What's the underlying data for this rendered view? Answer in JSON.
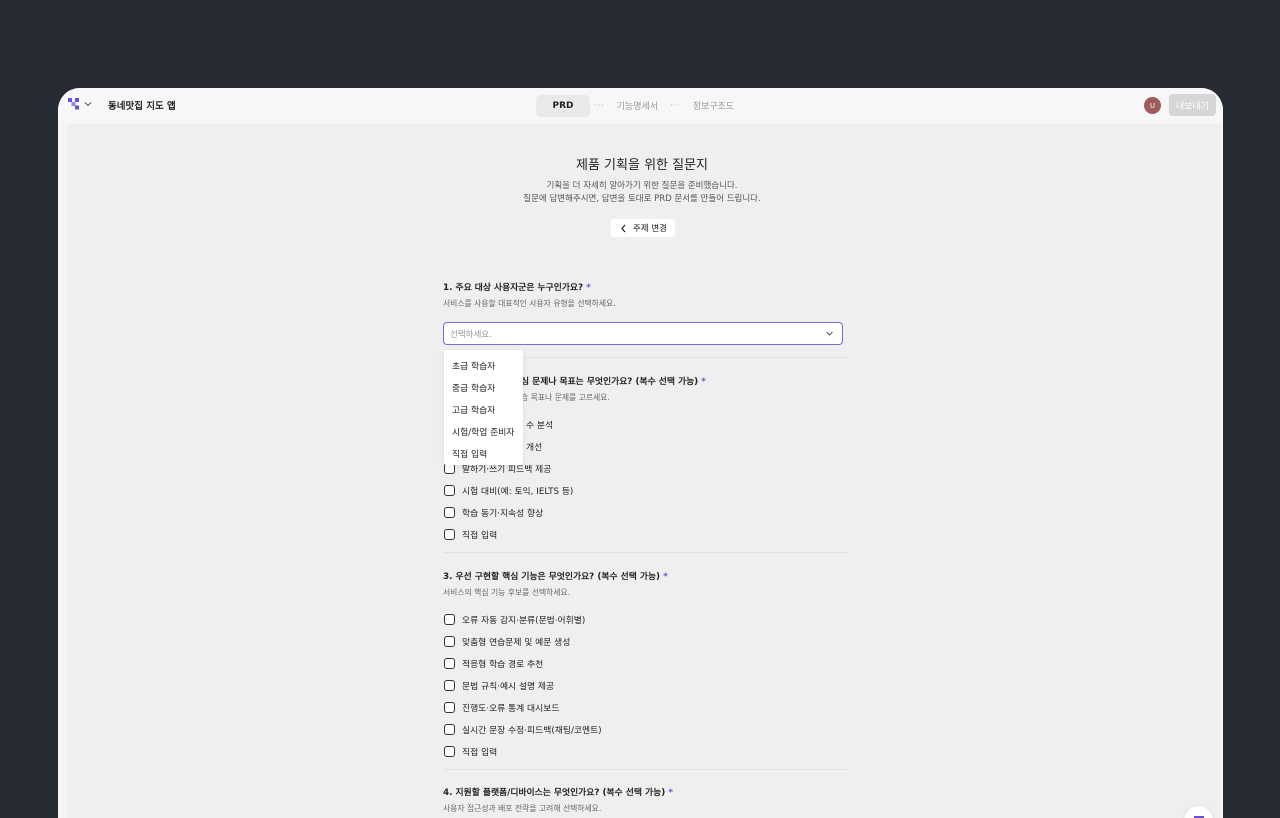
{
  "header": {
    "project_title": "동네맛집 지도 앱",
    "steps": [
      "PRD",
      "기능명세서",
      "정보구조도"
    ],
    "step_separator": "···",
    "avatar_initial": "U",
    "export_label": "내보내기"
  },
  "intro": {
    "title": "제품 기획을 위한 질문지",
    "line1": "기획을 더 자세히 알아가기 위한 질문을 준비했습니다.",
    "line2": "질문에 답변해주시면, 답변을 토대로 PRD 문서를 만들어 드립니다.",
    "back_label": "주제 변경"
  },
  "q1": {
    "title": "1. 주요 대상 사용자군은 누구인가요?",
    "required": "*",
    "help": "서비스를 사용할 대표적인 사용자 유형을 선택하세요.",
    "select_placeholder": "선택하세요.",
    "dropdown_options": [
      "초급 학습자",
      "중급 학습자",
      "고급 학습자",
      "시험/학업 준비자",
      "직접 입력"
    ]
  },
  "q2": {
    "title_visible": "심 문제나 목표는 무엇인가요? (복수 선택 가능)",
    "required": "*",
    "help_visible": "습 목표나 문제를 고르세요.",
    "options_visible": [
      "수 분석",
      "개선",
      "말하기·쓰기 피드백 제공",
      "시험 대비(예: 토익, IELTS 등)",
      "학습 동기·지속성 향상",
      "직접 입력"
    ]
  },
  "q3": {
    "title": "3. 우선 구현할 핵심 기능은 무엇인가요? (복수 선택 가능)",
    "required": "*",
    "help": "서비스의 핵심 기능 후보를 선택하세요.",
    "options": [
      "오류 자동 감지·분류(문법·어휘별)",
      "맞춤형 연습문제 및 예문 생성",
      "적응형 학습 경로 추천",
      "문법 규칙·예시 설명 제공",
      "진행도·오류 통계 대시보드",
      "실시간 문장 수정·피드백(채팅/코멘트)",
      "직접 입력"
    ]
  },
  "q4": {
    "title": "4. 지원할 플랫폼/디바이스는 무엇인가요? (복수 선택 가능)",
    "required": "*",
    "help": "사용자 접근성과 배포 전략을 고려해 선택하세요."
  },
  "colors": {
    "accent": "#6a4fd6",
    "background": "#252a33"
  }
}
